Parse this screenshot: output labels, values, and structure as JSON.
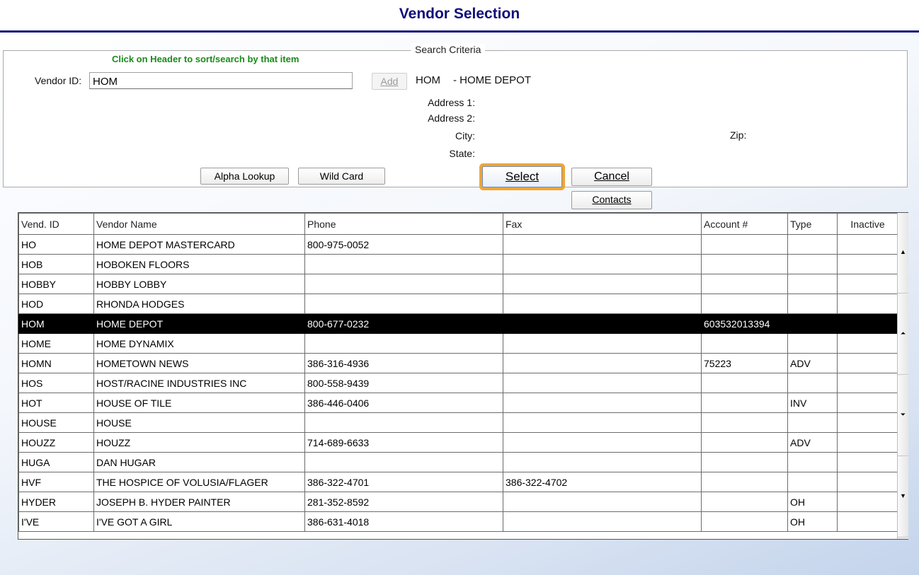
{
  "window": {
    "title": "Vendor Selection"
  },
  "criteria": {
    "legend": "Search Criteria",
    "hint": "Click on Header to sort/search by that item",
    "vendor_id_label": "Vendor ID:",
    "vendor_id_value": "HOM",
    "add_label": "Add",
    "selected_code": "HOM",
    "selected_name": "- HOME DEPOT",
    "address1_label": "Address 1:",
    "address2_label": "Address 2:",
    "city_label": "City:",
    "state_label": "State:",
    "zip_label": "Zip:"
  },
  "buttons": {
    "alpha_lookup": "Alpha Lookup",
    "wild_card": "Wild Card",
    "select": "Select",
    "cancel": "Cancel",
    "contacts": "Contacts"
  },
  "table": {
    "columns": [
      "Vend. ID",
      "Vendor Name",
      "Phone",
      "Fax",
      "Account #",
      "Type",
      "Inactive"
    ],
    "rows": [
      [
        "HO",
        "HOME DEPOT MASTERCARD",
        "800-975-0052",
        "",
        "",
        "",
        ""
      ],
      [
        "HOB",
        "HOBOKEN FLOORS",
        "",
        "",
        "",
        "",
        ""
      ],
      [
        "HOBBY",
        "HOBBY LOBBY",
        "",
        "",
        "",
        "",
        ""
      ],
      [
        "HOD",
        "RHONDA HODGES",
        "",
        "",
        "",
        "",
        ""
      ],
      [
        "HOM",
        "HOME DEPOT",
        "800-677-0232",
        "",
        "603532013394",
        "",
        ""
      ],
      [
        "HOME",
        "HOME DYNAMIX",
        "",
        "",
        "",
        "",
        ""
      ],
      [
        "HOMN",
        "HOMETOWN NEWS",
        "386-316-4936",
        "",
        "75223",
        "ADV",
        ""
      ],
      [
        "HOS",
        "HOST/RACINE INDUSTRIES INC",
        "800-558-9439",
        "",
        "",
        "",
        ""
      ],
      [
        "HOT",
        "HOUSE OF TILE",
        "386-446-0406",
        "",
        "",
        "INV",
        ""
      ],
      [
        "HOUSE",
        "HOUSE",
        "",
        "",
        "",
        "",
        ""
      ],
      [
        "HOUZZ",
        "HOUZZ",
        "714-689-6633",
        "",
        "",
        "ADV",
        ""
      ],
      [
        "HUGA",
        "DAN HUGAR",
        "",
        "",
        "",
        "",
        ""
      ],
      [
        "HVF",
        "THE HOSPICE OF VOLUSIA/FLAGER",
        "386-322-4701",
        "386-322-4702",
        "",
        "",
        ""
      ],
      [
        "HYDER",
        "JOSEPH B. HYDER PAINTER",
        "281-352-8592",
        "",
        "",
        "OH",
        ""
      ],
      [
        "I'VE",
        "I'VE GOT A GIRL",
        "386-631-4018",
        "",
        "",
        "OH",
        ""
      ]
    ],
    "selected_row": 4
  },
  "scrollbar": {
    "buttons": [
      {
        "name": "scroll-top-button",
        "glyph": "▲"
      },
      {
        "name": "scroll-page-up-button",
        "glyph": "⏶"
      },
      {
        "name": "scroll-page-down-button",
        "glyph": "⏷"
      },
      {
        "name": "scroll-bottom-button",
        "glyph": "▼"
      }
    ]
  }
}
